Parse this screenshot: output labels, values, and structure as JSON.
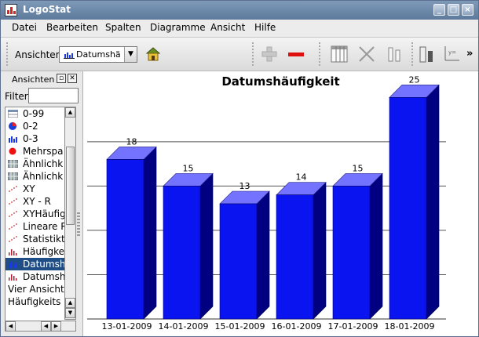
{
  "window": {
    "title": "LogoStat",
    "controls": [
      "_",
      "□",
      "×"
    ]
  },
  "menu": [
    "Datei",
    "Bearbeiten",
    "Spalten",
    "Diagramme",
    "Ansicht",
    "Hilfe"
  ],
  "toolbar": {
    "label": "Ansichten",
    "combo_value": "Datumshä",
    "buttons": [
      "home-icon",
      "add-icon",
      "remove-icon",
      "columns-icon",
      "delete-column-icon",
      "split-column-icon",
      "bar-chart-icon",
      "axis-icon"
    ],
    "overflow": "»"
  },
  "panel": {
    "title": "Ansichten",
    "filter_label": "Filter",
    "filter_value": "",
    "items": [
      {
        "label": "0-99",
        "icon": "table-icon"
      },
      {
        "label": "0-2",
        "icon": "pie-chart-icon"
      },
      {
        "label": "0-3",
        "icon": "bar-chart-icon"
      },
      {
        "label": "Mehrspa",
        "icon": "red-dot-icon"
      },
      {
        "label": "Ähnlichk",
        "icon": "grid-icon"
      },
      {
        "label": "Ähnlichk",
        "icon": "grid-icon"
      },
      {
        "label": "XY",
        "icon": "scatter-icon"
      },
      {
        "label": "XY - R",
        "icon": "scatter-icon"
      },
      {
        "label": "XYHäufig",
        "icon": "scatter-icon"
      },
      {
        "label": "Lineare R",
        "icon": "scatter-icon"
      },
      {
        "label": "Statistikta",
        "icon": "scatter-icon"
      },
      {
        "label": "Häufigke",
        "icon": "histogram-icon"
      },
      {
        "label": "Datumsh",
        "icon": "bar-chart-icon",
        "selected": true
      },
      {
        "label": "Datumsh",
        "icon": "histogram-icon"
      },
      {
        "label": "Vier Ansichte",
        "icon": ""
      },
      {
        "label": "Häufigkeits M",
        "icon": ""
      }
    ]
  },
  "colors": {
    "bar_front": "#0a14f0",
    "bar_top": "#7373ff",
    "bar_side": "#000080",
    "selection": "#1f4e86"
  },
  "chart_data": {
    "type": "bar",
    "title": "Datumshäufigkeit",
    "categories": [
      "13-01-2009",
      "14-01-2009",
      "15-01-2009",
      "16-01-2009",
      "17-01-2009",
      "18-01-2009"
    ],
    "values": [
      18,
      15,
      13,
      14,
      15,
      25
    ],
    "ylim": [
      0,
      26
    ],
    "gridlines": [
      5,
      10,
      15,
      20
    ],
    "grid": true,
    "style": "3d"
  }
}
